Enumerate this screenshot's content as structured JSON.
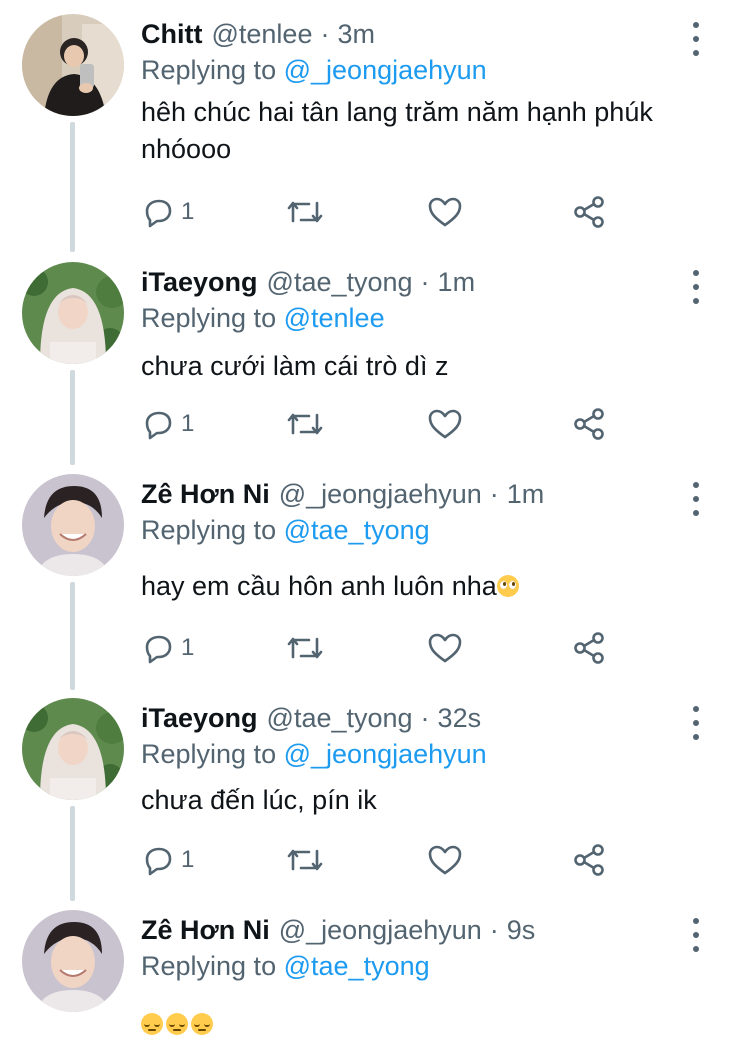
{
  "reply_prefix": "Replying to",
  "icons": {
    "reply": "speech-bubble-icon",
    "retweet": "retweet-icon",
    "like": "heart-icon",
    "share": "share-icon",
    "more": "more-vertical-icon"
  },
  "colors": {
    "link": "#1d9bf0",
    "secondary": "#536471",
    "thread_line": "#cfd9de"
  },
  "tweets": [
    {
      "name": "Chitt",
      "handle": "@tenlee",
      "time": "3m",
      "replying_to": "@_jeongjaehyun",
      "text": "hêh chúc hai tân lang trăm năm hạnh phúk nhóooo",
      "reply_count": "1"
    },
    {
      "name": "iTaeyong",
      "handle": "@tae_tyong",
      "time": "1m",
      "replying_to": "@tenlee",
      "text": "chưa cưới làm cái trò dì z",
      "reply_count": "1"
    },
    {
      "name": "Zê Hơn Ni",
      "handle": "@_jeongjaehyun",
      "time": "1m",
      "replying_to": "@tae_tyong",
      "text": "hay em cầu hôn anh luôn nha",
      "text_emoji": "pleading-face-emoji",
      "reply_count": "1"
    },
    {
      "name": "iTaeyong",
      "handle": "@tae_tyong",
      "time": "32s",
      "replying_to": "@_jeongjaehyun",
      "text": "chưa đến lúc, pín ik",
      "reply_count": "1"
    },
    {
      "name": "Zê Hơn Ni",
      "handle": "@_jeongjaehyun",
      "time": "9s",
      "replying_to": "@tae_tyong",
      "text_emoji": "pensive-face-emoji-x3"
    }
  ]
}
